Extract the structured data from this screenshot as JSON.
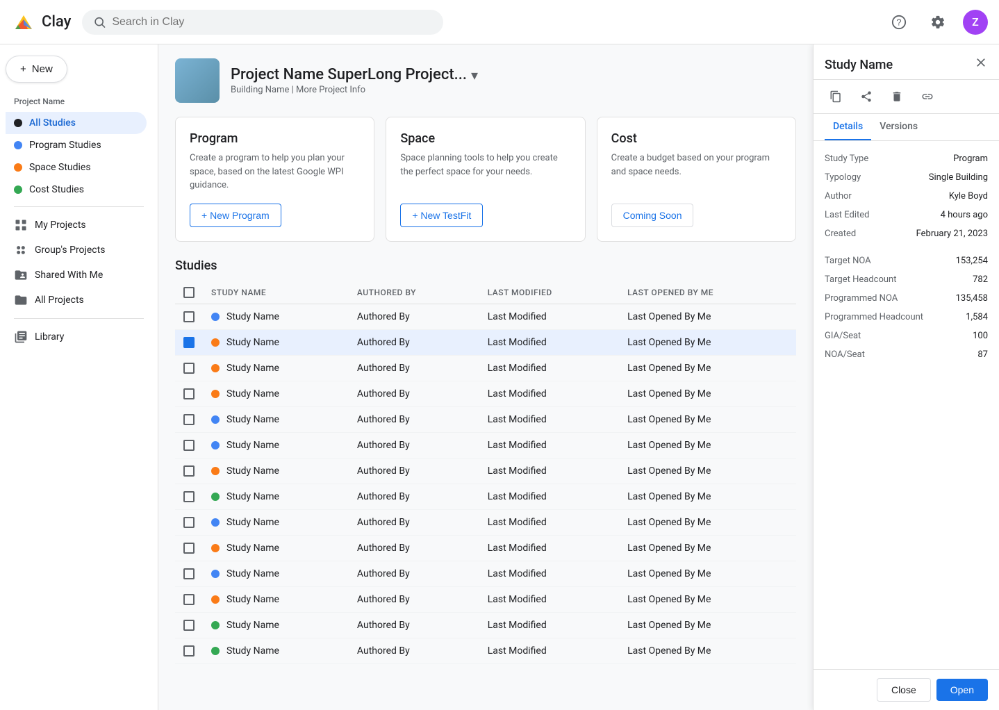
{
  "app": {
    "name": "Clay",
    "logo_text": "Clay"
  },
  "topbar": {
    "search_placeholder": "Search in Clay",
    "avatar_letter": "Z"
  },
  "sidebar": {
    "new_label": "New",
    "project_section_label": "Project Name",
    "nav_items": [
      {
        "id": "all-studies",
        "label": "All Studies",
        "dot": "dark",
        "active": true
      },
      {
        "id": "program-studies",
        "label": "Program Studies",
        "dot": "blue",
        "active": false
      },
      {
        "id": "space-studies",
        "label": "Space Studies",
        "dot": "orange",
        "active": false
      },
      {
        "id": "cost-studies",
        "label": "Cost Studies",
        "dot": "green",
        "active": false
      }
    ],
    "bottom_items": [
      {
        "id": "my-projects",
        "label": "My Projects",
        "icon": "grid"
      },
      {
        "id": "groups-projects",
        "label": "Group's Projects",
        "icon": "circle-grid"
      },
      {
        "id": "shared-with-me",
        "label": "Shared With Me",
        "icon": "folder-shared"
      },
      {
        "id": "all-projects",
        "label": "All Projects",
        "icon": "folder"
      },
      {
        "id": "library",
        "label": "Library",
        "icon": "library"
      }
    ]
  },
  "project": {
    "thumbnail_alt": "Project thumbnail",
    "title": "Project Name SuperLong Project...",
    "subtitle": "Building Name | More Project Info"
  },
  "cards": [
    {
      "id": "program",
      "title": "Program",
      "description": "Create a program to help you plan your space, based on the latest Google WPI guidance.",
      "button_label": "+ New Program"
    },
    {
      "id": "space",
      "title": "Space",
      "description": "Space planning tools to help you create the perfect space for your needs.",
      "button_label": "+ New TestFit"
    },
    {
      "id": "cost",
      "title": "Cost",
      "description": "Create a budget based on your program and space needs.",
      "button_label": "Coming Soon"
    }
  ],
  "studies": {
    "section_title": "Studies",
    "columns": [
      "STUDY NAME",
      "AUTHORED BY",
      "LAST MODIFIED",
      "LAST OPENED BY ME"
    ],
    "rows": [
      {
        "name": "Study Name",
        "authored_by": "Authored By",
        "last_modified": "Last Modified",
        "last_opened": "Last Opened By Me",
        "dot": "blue",
        "selected": false
      },
      {
        "name": "Study Name",
        "authored_by": "Authored By",
        "last_modified": "Last Modified",
        "last_opened": "Last Opened By Me",
        "dot": "orange",
        "selected": true
      },
      {
        "name": "Study Name",
        "authored_by": "Authored By",
        "last_modified": "Last Modified",
        "last_opened": "Last Opened By Me",
        "dot": "orange",
        "selected": false
      },
      {
        "name": "Study Name",
        "authored_by": "Authored By",
        "last_modified": "Last Modified",
        "last_opened": "Last Opened By Me",
        "dot": "orange",
        "selected": false
      },
      {
        "name": "Study Name",
        "authored_by": "Authored By",
        "last_modified": "Last Modified",
        "last_opened": "Last Opened By Me",
        "dot": "blue",
        "selected": false
      },
      {
        "name": "Study Name",
        "authored_by": "Authored By",
        "last_modified": "Last Modified",
        "last_opened": "Last Opened By Me",
        "dot": "blue",
        "selected": false
      },
      {
        "name": "Study Name",
        "authored_by": "Authored By",
        "last_modified": "Last Modified",
        "last_opened": "Last Opened By Me",
        "dot": "orange",
        "selected": false
      },
      {
        "name": "Study Name",
        "authored_by": "Authored By",
        "last_modified": "Last Modified",
        "last_opened": "Last Opened By Me",
        "dot": "green",
        "selected": false
      },
      {
        "name": "Study Name",
        "authored_by": "Authored By",
        "last_modified": "Last Modified",
        "last_opened": "Last Opened By Me",
        "dot": "blue",
        "selected": false
      },
      {
        "name": "Study Name",
        "authored_by": "Authored By",
        "last_modified": "Last Modified",
        "last_opened": "Last Opened By Me",
        "dot": "orange",
        "selected": false
      },
      {
        "name": "Study Name",
        "authored_by": "Authored By",
        "last_modified": "Last Modified",
        "last_opened": "Last Opened By Me",
        "dot": "blue",
        "selected": false
      },
      {
        "name": "Study Name",
        "authored_by": "Authored By",
        "last_modified": "Last Modified",
        "last_opened": "Last Opened By Me",
        "dot": "orange",
        "selected": false
      },
      {
        "name": "Study Name",
        "authored_by": "Authored By",
        "last_modified": "Last Modified",
        "last_opened": "Last Opened By Me",
        "dot": "green",
        "selected": false
      },
      {
        "name": "Study Name",
        "authored_by": "Authored By",
        "last_modified": "Last Modified",
        "last_opened": "Last Opened By Me",
        "dot": "green",
        "selected": false
      }
    ]
  },
  "panel": {
    "title": "Study Name",
    "tabs": [
      "Details",
      "Versions"
    ],
    "active_tab": "Details",
    "details": [
      {
        "label": "Study Type",
        "value": "Program"
      },
      {
        "label": "Typology",
        "value": "Single Building"
      },
      {
        "label": "Author",
        "value": "Kyle Boyd"
      },
      {
        "label": "Last Edited",
        "value": "4 hours ago"
      },
      {
        "label": "Created",
        "value": "February 21, 2023"
      }
    ],
    "metrics": [
      {
        "label": "Target NOA",
        "value": "153,254"
      },
      {
        "label": "Target Headcount",
        "value": "782"
      },
      {
        "label": "Programmed NOA",
        "value": "135,458"
      },
      {
        "label": "Programmed Headcount",
        "value": "1,584"
      },
      {
        "label": "GIA/Seat",
        "value": "100"
      },
      {
        "label": "NOA/Seat",
        "value": "87"
      }
    ],
    "close_label": "Close",
    "open_label": "Open"
  }
}
